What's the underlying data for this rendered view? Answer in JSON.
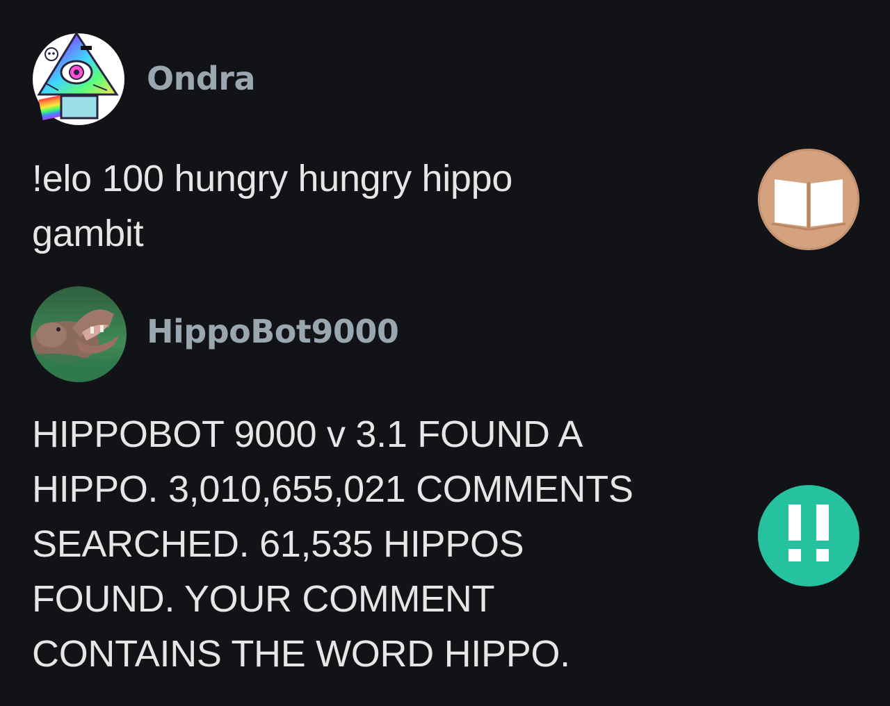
{
  "comments": [
    {
      "username": "Ondra",
      "text_lines": [
        "!elo 100 hungry hungry hippo",
        "gambit"
      ],
      "award_icon": "book-icon",
      "award_color": "#d4a27f"
    },
    {
      "username": "HippoBot9000",
      "text_lines": [
        "HIPPOBOT 9000 v 3.1 FOUND A",
        "HIPPO. 3,010,655,021 COMMENTS",
        "SEARCHED. 61,535 HIPPOS",
        "FOUND. YOUR COMMENT",
        "CONTAINS THE WORD HIPPO."
      ],
      "award_icon": "double-exclamation-icon",
      "award_color": "#26c2a0"
    }
  ],
  "colors": {
    "background": "#121316",
    "username": "#9aa6b0",
    "text": "#e6e6e6"
  }
}
